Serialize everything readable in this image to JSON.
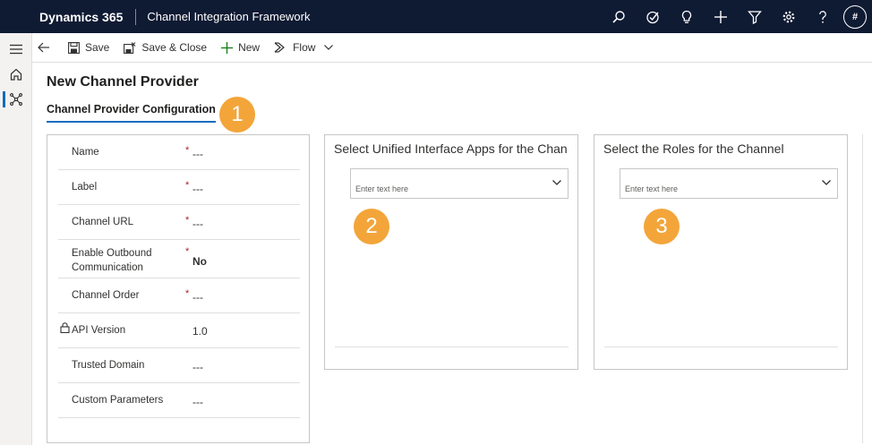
{
  "header": {
    "brand": "Dynamics 365",
    "app_name": "Channel Integration Framework",
    "avatar_initial": "#",
    "icons": [
      "search-icon",
      "task-icon",
      "lightbulb-icon",
      "plus-icon",
      "filter-icon",
      "gear-icon",
      "help-icon"
    ]
  },
  "rail": {
    "items": [
      "hamburger-icon",
      "home-icon",
      "channel-icon"
    ]
  },
  "commands": {
    "save": "Save",
    "save_close": "Save & Close",
    "new": "New",
    "flow": "Flow"
  },
  "page": {
    "title": "New Channel Provider",
    "tab": "Channel Provider Configuration"
  },
  "callouts": {
    "one": "1",
    "two": "2",
    "three": "3"
  },
  "fields": [
    {
      "label": "Name",
      "required": "*",
      "value": "---"
    },
    {
      "label": "Label",
      "required": "*",
      "value": "---"
    },
    {
      "label": "Channel URL",
      "required": "*",
      "value": "---"
    },
    {
      "label": "Enable Outbound Communication",
      "required": "*",
      "value": "No"
    },
    {
      "label": "Channel Order",
      "required": "*",
      "value": "---"
    },
    {
      "label": "API Version",
      "required": "",
      "value": "1.0"
    },
    {
      "label": "Trusted Domain",
      "required": "",
      "value": "---"
    },
    {
      "label": "Custom Parameters",
      "required": "",
      "value": "---"
    }
  ],
  "apps_panel": {
    "title": "Select Unified Interface Apps for the Chan...",
    "placeholder": "Enter text here"
  },
  "roles_panel": {
    "title": "Select the Roles for the Channel",
    "placeholder": "Enter text here"
  },
  "colors": {
    "topbar": "#0f1a33",
    "accent": "#0f6cbd",
    "callout": "#f3a53a",
    "required": "#a4262c"
  }
}
